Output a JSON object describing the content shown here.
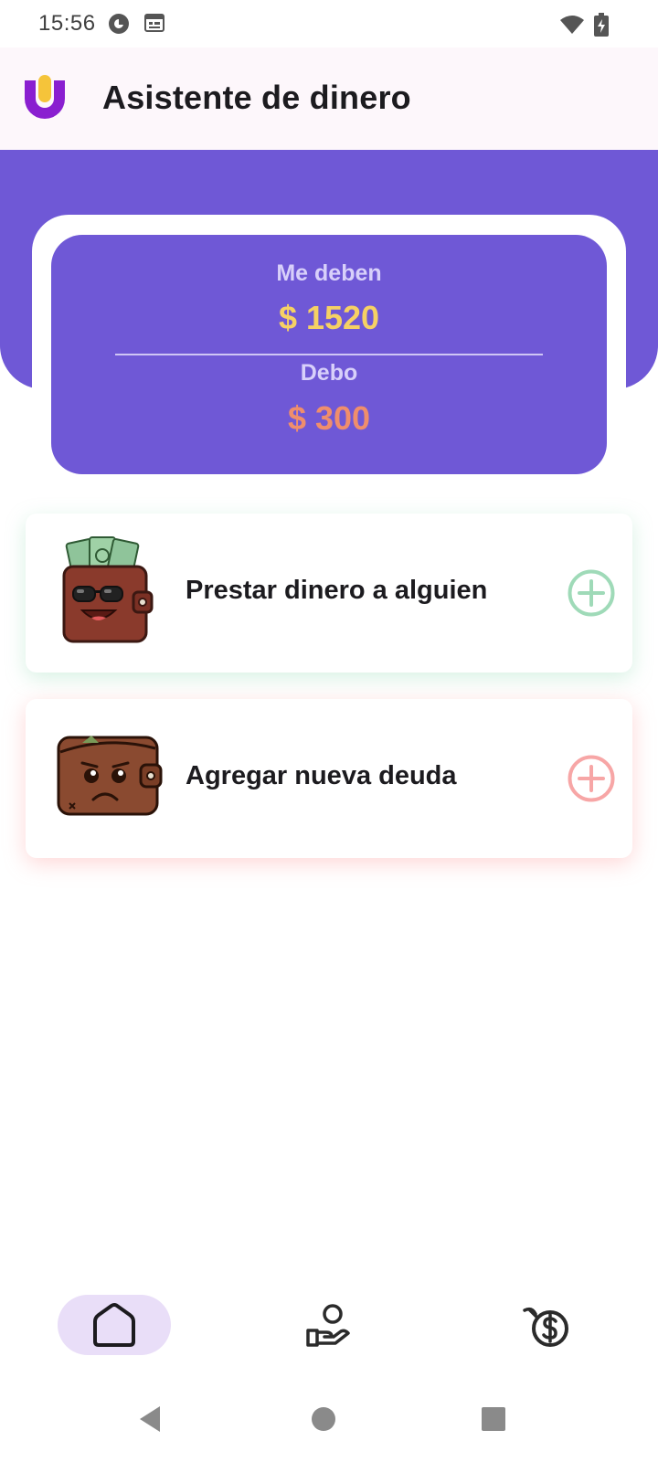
{
  "status_bar": {
    "time": "15:56",
    "icons": [
      "vpn-key-icon",
      "calendar-icon",
      "wifi-icon",
      "battery-charging-icon"
    ]
  },
  "app_bar": {
    "title": "Asistente de dinero",
    "logo_icon": "app-logo-icon"
  },
  "balance": {
    "owed_to_me_label": "Me deben",
    "owed_to_me_amount": "$ 1520",
    "i_owe_label": "Debo",
    "i_owe_amount": "$ 300"
  },
  "actions": [
    {
      "label": "Prestar dinero a alguien",
      "image": "happy-wallet-illustration",
      "icon": "plus-circle-icon",
      "accent": "#9fdab8"
    },
    {
      "label": "Agregar nueva deuda",
      "image": "sad-wallet-illustration",
      "icon": "plus-circle-icon",
      "accent": "#f7a6a6"
    }
  ],
  "bottom_nav": [
    {
      "icon": "home-icon",
      "selected": true
    },
    {
      "icon": "hand-person-icon",
      "selected": false
    },
    {
      "icon": "dollar-debt-icon",
      "selected": false
    }
  ],
  "system_nav": [
    "back-icon",
    "home-circle-icon",
    "recents-icon"
  ],
  "colors": {
    "primary": "#6f58d6",
    "owed_amount": "#f6d164",
    "owe_amount": "#ef8e6c",
    "nav_selected": "#e9def8"
  }
}
